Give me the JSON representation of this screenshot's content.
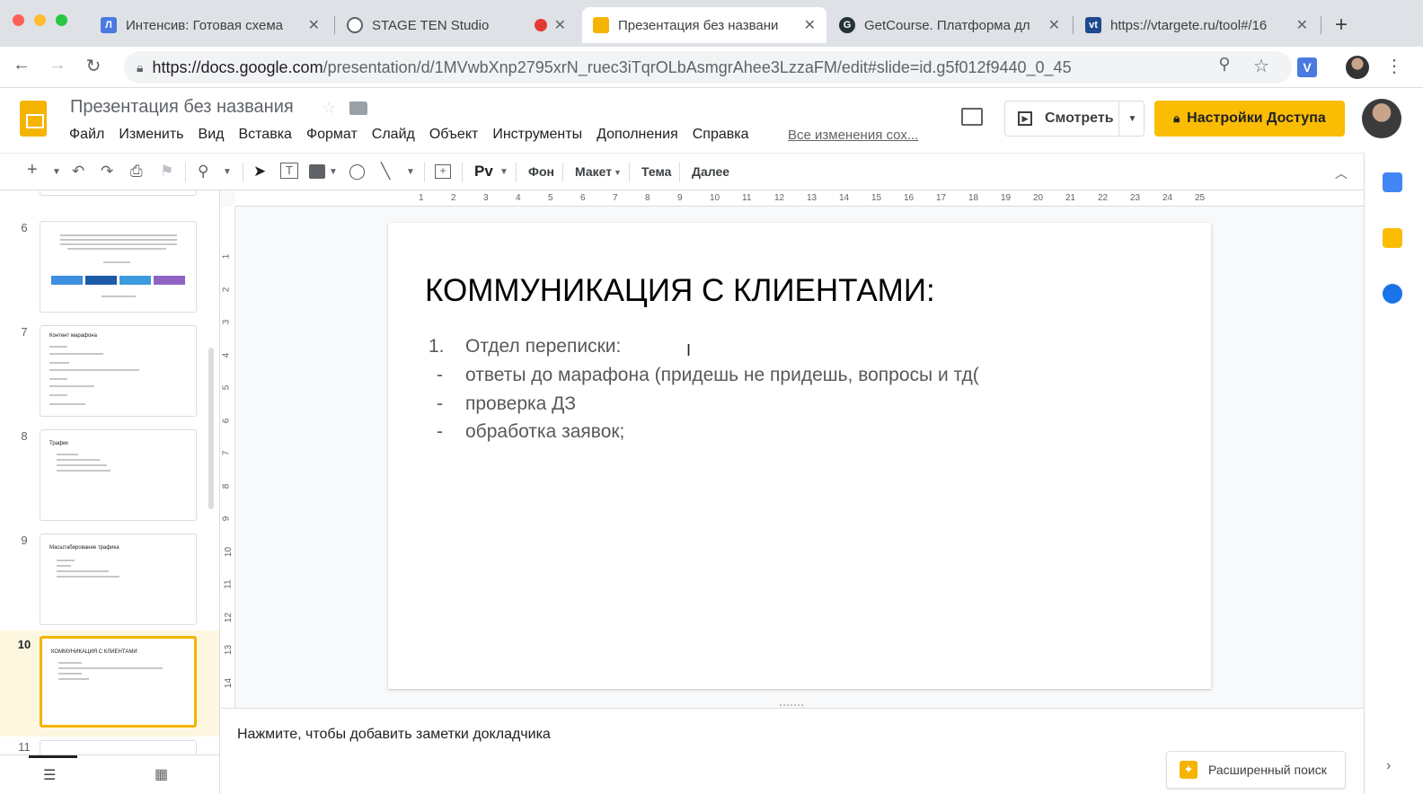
{
  "tabs": [
    {
      "title": "Интенсив: Готовая схема",
      "active": false
    },
    {
      "title": "STAGE TEN Studio",
      "active": false
    },
    {
      "title": "Презентация без названи",
      "active": true
    },
    {
      "title": "GetCourse. Платформа дл",
      "active": false
    },
    {
      "title": "https://vtargete.ru/tool#/16",
      "active": false
    }
  ],
  "url": {
    "host": "https://docs.google.com",
    "path": "/presentation/d/1MVwbXnp2795xrN_ruec3iTqrOLbAsmgrAhee3LzzaFM/edit#slide=id.g5f012f9440_0_45"
  },
  "doc": {
    "title": "Презентация без названия",
    "saved_status": "Все изменения сох..."
  },
  "menu": [
    "Файл",
    "Изменить",
    "Вид",
    "Вставка",
    "Формат",
    "Слайд",
    "Объект",
    "Инструменты",
    "Дополнения",
    "Справка"
  ],
  "buttons": {
    "present": "Смотреть",
    "share": "Настройки Доступа"
  },
  "toolbar": {
    "background": "Фон",
    "layout": "Макет",
    "theme": "Тема",
    "transition": "Далее"
  },
  "filmstrip": [
    {
      "num": "6",
      "title": ""
    },
    {
      "num": "7",
      "title": "Контент марафона"
    },
    {
      "num": "8",
      "title": "Трафик"
    },
    {
      "num": "9",
      "title": "Масштабирование трафика"
    },
    {
      "num": "10",
      "title": "КОММУНИКАЦИЯ С КЛИЕНТАМИ"
    },
    {
      "num": "11",
      "title": ""
    }
  ],
  "ruler_h": [
    "1",
    "2",
    "3",
    "4",
    "5",
    "6",
    "7",
    "8",
    "9",
    "10",
    "11",
    "12",
    "13",
    "14",
    "15",
    "16",
    "17",
    "18",
    "19",
    "20",
    "21",
    "22",
    "23",
    "24",
    "25"
  ],
  "ruler_v": [
    "1",
    "2",
    "3",
    "4",
    "5",
    "6",
    "7",
    "8",
    "9",
    "10",
    "11",
    "12",
    "13",
    "14"
  ],
  "slide": {
    "title": "КОММУНИКАЦИЯ С КЛИЕНТАМИ:",
    "list": [
      {
        "marker": "1.",
        "text": "Отдел переписки:"
      },
      {
        "marker": "-",
        "text": "ответы до марафона (придешь не придешь, вопросы и тд("
      },
      {
        "marker": "-",
        "text": "проверка ДЗ"
      },
      {
        "marker": "-",
        "text": "обработка заявок;"
      }
    ]
  },
  "notes": {
    "placeholder": "Нажмите, чтобы добавить заметки докладчика"
  },
  "explore": {
    "label": "Расширенный поиск"
  },
  "colors": {
    "accent": "#fbbc04",
    "slides_yellow": "#f4b400",
    "selected_bg": "#fef7e0"
  }
}
